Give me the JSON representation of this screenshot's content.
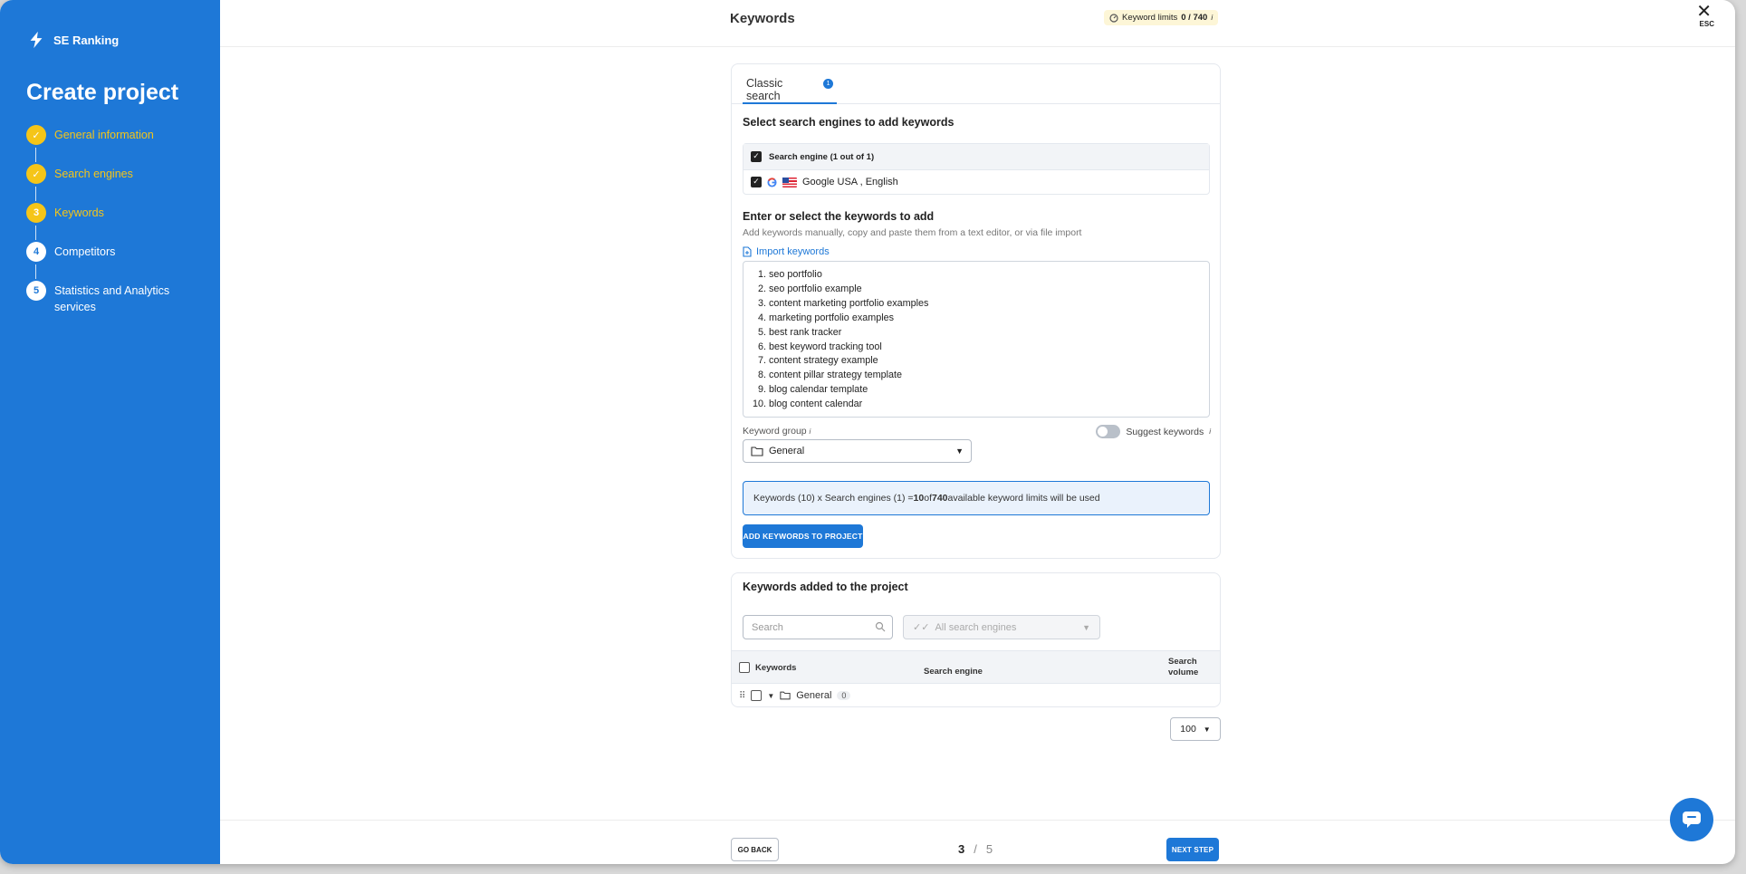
{
  "sidebar": {
    "logo_text": "SE Ranking",
    "title": "Create project",
    "steps": [
      {
        "num": "✓",
        "label": "General information",
        "state": "done"
      },
      {
        "num": "✓",
        "label": "Search engines",
        "state": "done"
      },
      {
        "num": "3",
        "label": "Keywords",
        "state": "current"
      },
      {
        "num": "4",
        "label": "Competitors",
        "state": "todo"
      },
      {
        "num": "5",
        "label": "Statistics and Analytics services",
        "state": "todo"
      }
    ]
  },
  "header": {
    "title": "Keywords",
    "limits_label": "Keyword limits",
    "limits_value": "0 / 740",
    "info_mark": "i",
    "close": "✕",
    "esc": "ESC"
  },
  "tabs": [
    {
      "label": "Classic search",
      "badge": "1"
    }
  ],
  "engines": {
    "section_title": "Select search engines to add keywords",
    "head_label": "Search engine (1 out of 1)",
    "rows": [
      {
        "label": "Google USA , English"
      }
    ]
  },
  "keywords_input": {
    "section_title": "Enter or select the keywords to add",
    "subtitle": "Add keywords manually, copy and paste them from a text editor, or via file import",
    "import_label": "Import keywords",
    "lines": [
      {
        "n": "1.",
        "text": "seo portfolio"
      },
      {
        "n": "2.",
        "text": "seo portfolio example"
      },
      {
        "n": "3.",
        "text": "content marketing portfolio examples"
      },
      {
        "n": "4.",
        "text": "marketing portfolio examples"
      },
      {
        "n": "5.",
        "text": "best rank tracker"
      },
      {
        "n": "6.",
        "text": "best keyword tracking tool"
      },
      {
        "n": "7.",
        "text": "content strategy example"
      },
      {
        "n": "8.",
        "text": "content pillar strategy template"
      },
      {
        "n": "9.",
        "text": "blog calendar template"
      },
      {
        "n": "10.",
        "text": "blog content calendar"
      }
    ],
    "group_label": "Keyword group",
    "group_value": "General",
    "suggest_label": "Suggest keywords",
    "info_prefix": "Keywords (10) x Search engines (1) = ",
    "info_used": "10",
    "info_of": " of ",
    "info_total": "740",
    "info_suffix": " available keyword limits will be used",
    "add_button": "ADD KEYWORDS TO PROJECT"
  },
  "added": {
    "section_title": "Keywords added to the project",
    "search_placeholder": "Search",
    "engines_select": "All search engines",
    "col_keywords": "Keywords",
    "col_engine": "Search engine",
    "col_volume": "Search volume",
    "group_name": "General",
    "group_count": "0",
    "per_page": "100"
  },
  "footer": {
    "go_back": "GO BACK",
    "current_page": "3",
    "separator": "/",
    "total_pages": "5",
    "next": "NEXT STEP"
  },
  "colors": {
    "accent": "#1e78d7",
    "step_done": "#f5c518"
  }
}
